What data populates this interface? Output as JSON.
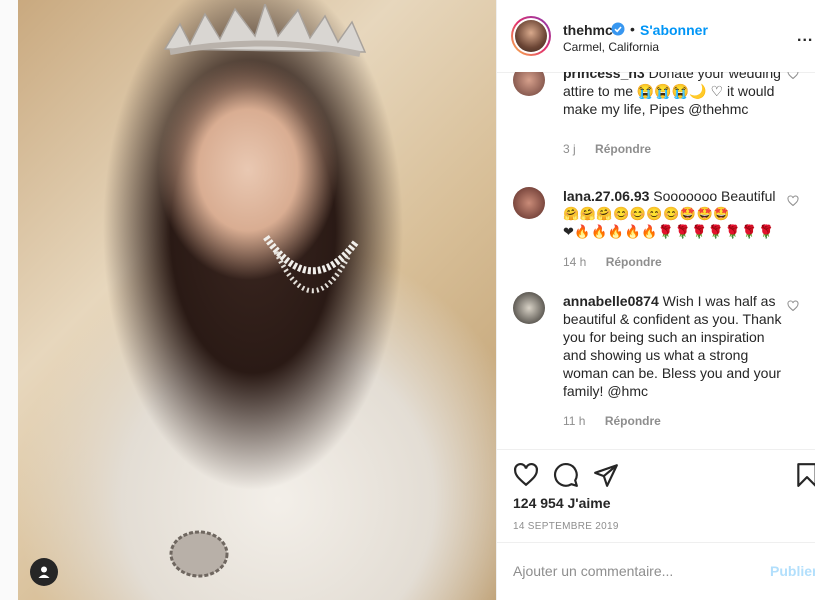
{
  "post": {
    "author": {
      "username": "thehmc",
      "follow_label": "S'abonner",
      "location": "Carmel, California",
      "more_label": "..."
    },
    "comments": [
      {
        "username": "princess_h3",
        "text": "Donate your wedding attire to me 😭😭😭🌙 ♡ it would make my life, Pipes @thehmc",
        "time": "3 j",
        "reply_label": "Répondre"
      },
      {
        "username": "lana.27.06.93",
        "text": "Sooooooo Beautiful",
        "emoji_line1": "🤗🤗🤗😊😊😊😊🤩🤩🤩",
        "emoji_line2": "❤🔥🔥🔥🔥🔥🌹🌹🌹🌹🌹🌹🌹",
        "time": "14 h",
        "reply_label": "Répondre"
      },
      {
        "username": "annabelle0874",
        "text": "Wish I was half as beautiful & confident as you. Thank you for being such an inspiration and showing us what a strong woman can be. Bless you and your family! @hmc",
        "time": "11 h",
        "reply_label": "Répondre"
      }
    ],
    "likes": "124 954 J'aime",
    "date": "14 SEPTEMBRE 2019",
    "add_comment": {
      "placeholder": "Ajouter un commentaire...",
      "publish_label": "Publier"
    },
    "icons": [
      "heart-icon",
      "comment-icon",
      "share-icon",
      "bookmark-icon",
      "user-tag-icon",
      "verified-badge-icon",
      "more-options-icon"
    ],
    "colors": {
      "link": "#0095f6",
      "verified": "#3897f0",
      "muted": "#8e8e8e",
      "publish_disabled": "#b2dffc"
    }
  }
}
